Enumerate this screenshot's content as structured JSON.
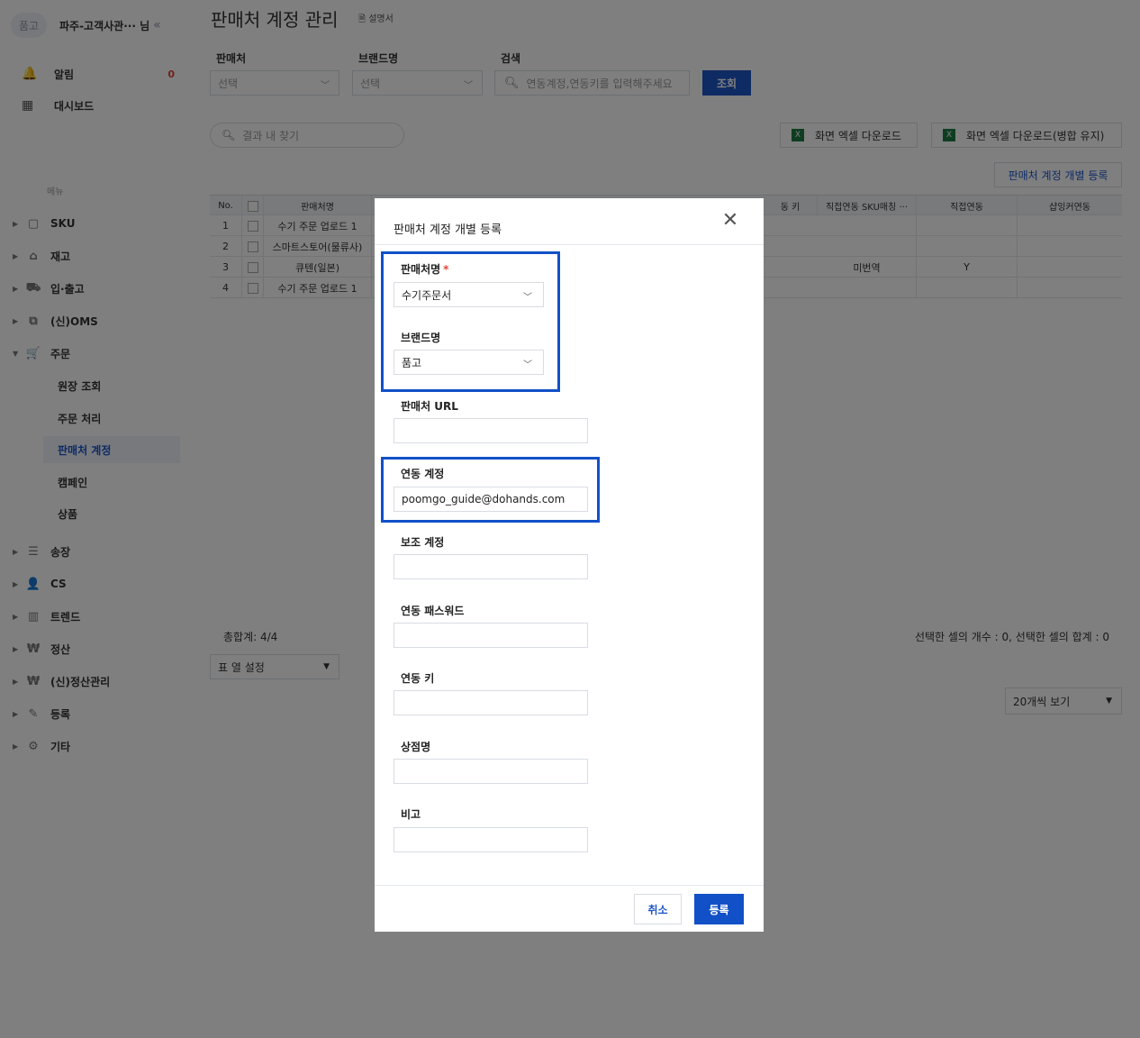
{
  "sidebar": {
    "org_badge": "품고",
    "org_name": "파주-고객사관··· 님",
    "collapse_glyph": "«",
    "top_items": [
      {
        "label": "알림",
        "badge": "0"
      },
      {
        "label": "대시보드"
      }
    ],
    "menu_heading": "메뉴",
    "nav": [
      {
        "label": "SKU"
      },
      {
        "label": "재고"
      },
      {
        "label": "입·출고"
      },
      {
        "label": "(신)OMS"
      },
      {
        "label": "주문"
      },
      {
        "label": "송장"
      },
      {
        "label": "CS"
      },
      {
        "label": "트렌드"
      },
      {
        "label": "정산"
      },
      {
        "label": "(신)정산관리"
      },
      {
        "label": "등록"
      },
      {
        "label": "기타"
      }
    ],
    "order_sub": [
      {
        "label": "원장 조회"
      },
      {
        "label": "주문 처리"
      },
      {
        "label": "판매처 계정"
      },
      {
        "label": "캠페인"
      },
      {
        "label": "상품"
      }
    ]
  },
  "header": {
    "title": "판매처 계정 관리",
    "manual_label": "설명서"
  },
  "filters": {
    "vendor_label": "판매처",
    "vendor_value": "선택",
    "brand_label": "브랜드명",
    "brand_value": "선택",
    "search_label": "검색",
    "search_placeholder": "연동계정,연동키를 입력해주세요",
    "query_button": "조회"
  },
  "toolbar": {
    "result_search_placeholder": "결과 내 찾기",
    "excel_download": "화면 엑셀 다운로드",
    "excel_download_merged": "화면 엑셀 다운로드(병합 유지)",
    "register_button": "판매처 계정 개별 등록"
  },
  "table": {
    "headers": {
      "no": "No.",
      "vendor": "판매처명",
      "key": "동 키",
      "sku": "직접연동 SKU매칭 ···",
      "direct": "직접연동",
      "shopify": "샵잉커연동"
    },
    "rows": [
      {
        "no": "1",
        "vendor": "수기 주문 업로드 1",
        "sku": "",
        "direct": ""
      },
      {
        "no": "2",
        "vendor": "스마트스토어(물류사)",
        "sku": "",
        "direct": ""
      },
      {
        "no": "3",
        "vendor": "큐텐(일본)",
        "sku": "미번역",
        "direct": "Y"
      },
      {
        "no": "4",
        "vendor": "수기 주문 업로드 1",
        "sku": "",
        "direct": ""
      }
    ]
  },
  "footer": {
    "total": "총합계: 4/4",
    "selection_summary": "선택한 셀의 개수 : 0, 선택한 셀의 합계 : 0",
    "column_setting": "표 열 설정",
    "page_size": "20개씩 보기"
  },
  "modal": {
    "title": "판매처 계정 개별 등록",
    "vendor_label": "판매처명",
    "required_mark": "*",
    "vendor_value": "수기주문서",
    "brand_label": "브랜드명",
    "brand_value": "품고",
    "url_label": "판매처 URL",
    "url_value": "",
    "account_label": "연동 계정",
    "account_value": "poomgo_guide@dohands.com",
    "sub_account_label": "보조 계정",
    "sub_account_value": "",
    "password_label": "연동 패스워드",
    "password_value": "",
    "key_label": "연동 키",
    "key_value": "",
    "store_label": "상점명",
    "store_value": "",
    "note_label": "비고",
    "note_value": "",
    "cancel_button": "취소",
    "submit_button": "등록"
  },
  "colors": {
    "primary": "#1250c7",
    "highlight_border": "#1250c7",
    "badge_red": "#e0483a",
    "overlay": "rgba(0,0,0,0.5)"
  }
}
